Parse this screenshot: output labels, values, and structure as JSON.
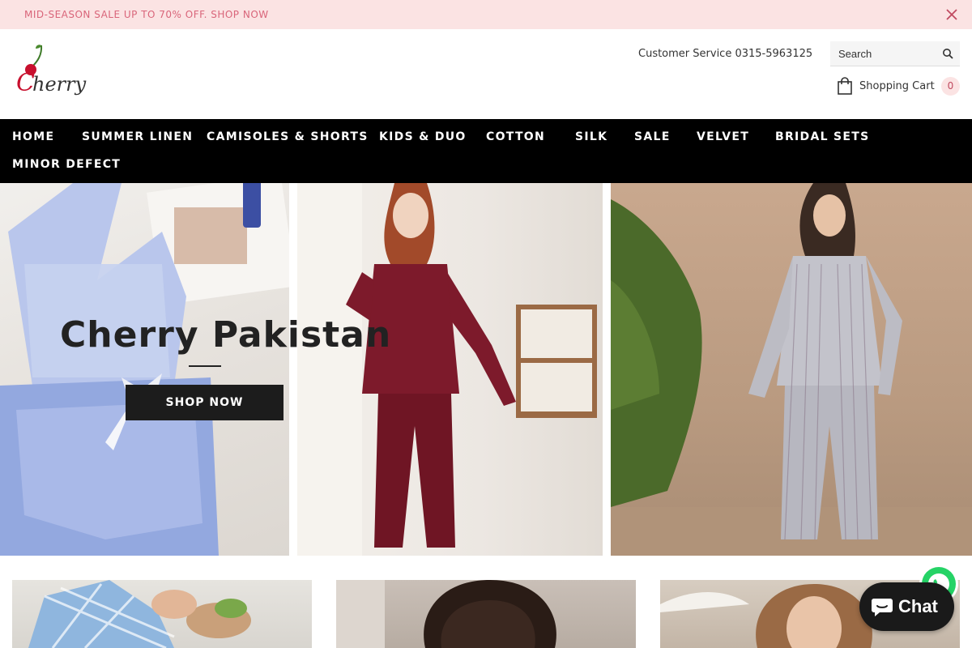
{
  "announcement": {
    "text": "MID-SEASON SALE UP TO 70% OFF.  SHOP NOW"
  },
  "header": {
    "logo_text": "Cherry",
    "customer_service": "Customer Service 0315-5963125",
    "search": {
      "placeholder": "Search"
    },
    "cart": {
      "label": "Shopping Cart",
      "count": "0"
    }
  },
  "nav": {
    "items": [
      {
        "label": "HOME"
      },
      {
        "label": "SUMMER LINEN"
      },
      {
        "label": "CAMISOLES & SHORTS"
      },
      {
        "label": "KIDS & DUO"
      },
      {
        "label": "COTTON"
      },
      {
        "label": "SILK"
      },
      {
        "label": "SALE"
      },
      {
        "label": "VELVET"
      },
      {
        "label": "BRIDAL SETS"
      },
      {
        "label": "MINOR DEFECT"
      }
    ]
  },
  "hero": {
    "title": "Cherry Pakistan",
    "button_label": "SHOP NOW"
  },
  "chat": {
    "label": "Chat"
  },
  "colors": {
    "announcement_bg": "#fbe3e3",
    "announcement_text": "#d9657a",
    "nav_bg": "#000000",
    "button_bg": "#1c1c1c",
    "whatsapp": "#25d366"
  }
}
